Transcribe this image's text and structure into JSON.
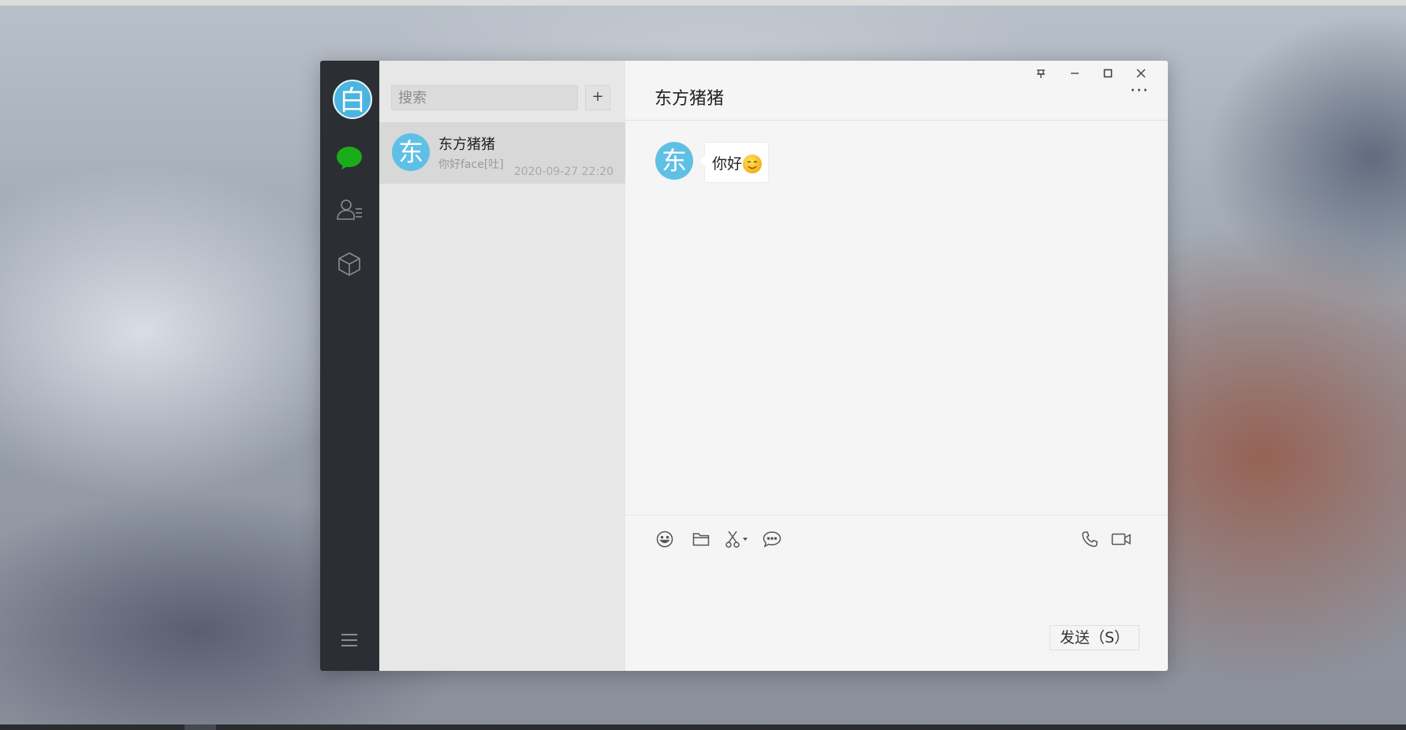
{
  "me": {
    "avatar_text": "白"
  },
  "search": {
    "placeholder": "搜索",
    "add_label": "+"
  },
  "sessions": [
    {
      "avatar_text": "东",
      "name": "东方猪猪",
      "preview": "你好face[吐]",
      "time": "2020-09-27 22:20"
    }
  ],
  "chat": {
    "title": "东方猪猪",
    "more_label": "···",
    "messages": [
      {
        "avatar_text": "东",
        "text": "你好",
        "emoji": "smile-face"
      }
    ]
  },
  "window_controls": {
    "pin": "⊼",
    "minimize": "–",
    "maximize": "□",
    "close": "✕"
  },
  "send": {
    "label": "发送（S）"
  },
  "icons": {
    "chat": "chat-bubble-icon",
    "contacts": "contacts-icon",
    "favorites": "cube-icon",
    "menu": "hamburger-icon",
    "emoji": "emoji-icon",
    "folder": "folder-icon",
    "screenshot": "scissors-icon",
    "history": "chat-history-icon",
    "phone": "phone-icon",
    "video": "video-icon"
  },
  "colors": {
    "accent_green": "#1aad19",
    "avatar_blue": "#5fc0e6",
    "nav_bg": "#2b2e33"
  }
}
